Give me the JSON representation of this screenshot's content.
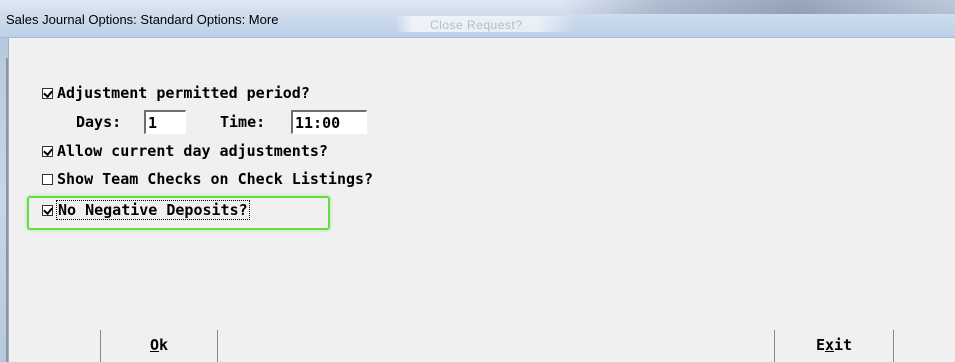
{
  "window": {
    "title": "Sales Journal Options:  Standard Options: More",
    "background_ghost_text": "Close  Request?"
  },
  "options": {
    "adjustment_period": {
      "label": "Adjustment permitted period?",
      "checked": true
    },
    "days": {
      "label": "Days:",
      "value": "1"
    },
    "time": {
      "label": "Time:",
      "value": "11:00"
    },
    "allow_current_day": {
      "label": "Allow current day adjustments?",
      "checked": true
    },
    "show_team_checks": {
      "label": "Show Team Checks on Check Listings?",
      "checked": false
    },
    "no_negative_deposits": {
      "label": "No Negative Deposits?",
      "checked": true
    }
  },
  "buttons": {
    "ok": {
      "mnemonic": "O",
      "rest": "k"
    },
    "exit": {
      "prefix": "E",
      "mnemonic": "x",
      "rest": "it"
    }
  },
  "colors": {
    "highlight": "#66dd44",
    "dialog_background": "#f0f0f0"
  }
}
